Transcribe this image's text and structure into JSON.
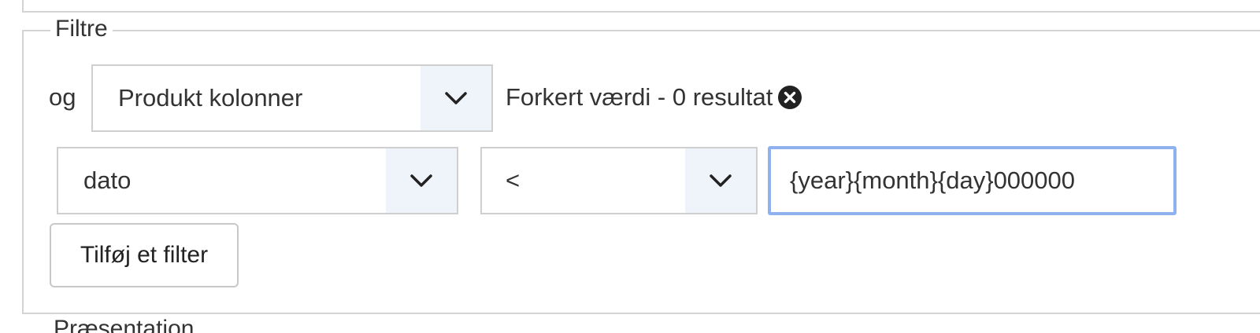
{
  "filters": {
    "legend": "Filtre",
    "conjunction": "og",
    "column_group_select": {
      "selected": "Produkt kolonner",
      "arrow_icon": "chevron-down-icon"
    },
    "error_message": "Forkert værdi - 0 resultat",
    "clear_icon": "x-circle-icon",
    "field_select": {
      "selected": "dato",
      "arrow_icon": "chevron-down-icon"
    },
    "operator_select": {
      "selected": "<",
      "arrow_icon": "chevron-down-icon"
    },
    "value_input": {
      "value": "{year}{month}{day}000000"
    },
    "add_filter_button": "Tilføj et filter"
  },
  "next_section": {
    "legend": "Præsentation"
  },
  "colors": {
    "border": "#d4d4d4",
    "select_arrow_bg": "#eff3fa",
    "focus_ring": "#8fb2ef",
    "text": "#333333"
  }
}
